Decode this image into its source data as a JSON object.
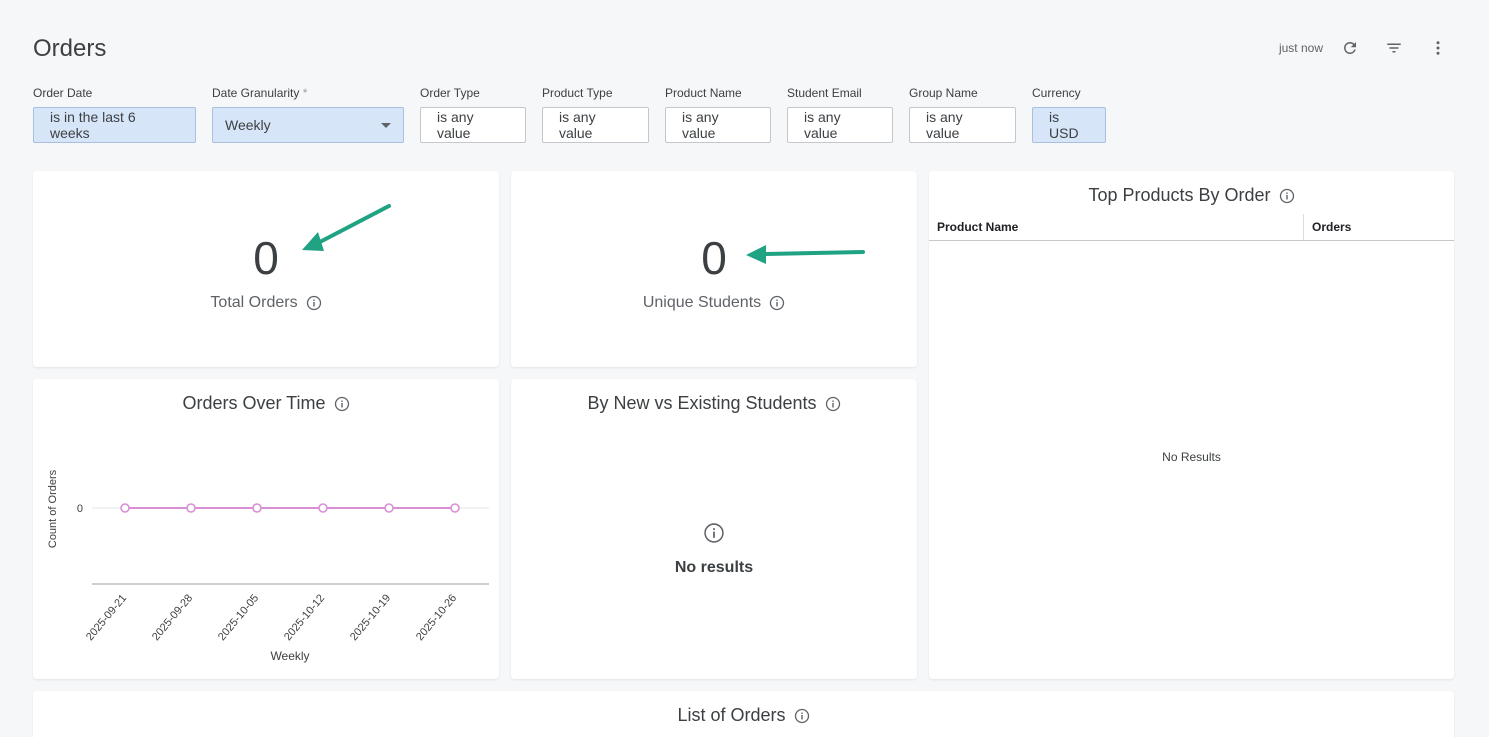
{
  "header": {
    "title": "Orders",
    "refresh_status": "just now",
    "icons": [
      "refresh-icon",
      "filter-icon",
      "more-vert-icon"
    ]
  },
  "filters": [
    {
      "label": "Order Date",
      "value": "is in the last 6 weeks",
      "active": true
    },
    {
      "label": "Date Granularity",
      "required_mark": "*",
      "value": "Weekly",
      "type": "select",
      "active": true
    },
    {
      "label": "Order Type",
      "value": "is any value",
      "active": false
    },
    {
      "label": "Product Type",
      "value": "is any value",
      "active": false
    },
    {
      "label": "Product Name",
      "value": "is any value",
      "active": false
    },
    {
      "label": "Student Email",
      "value": "is any value",
      "active": false
    },
    {
      "label": "Group Name",
      "value": "is any value",
      "active": false
    },
    {
      "label": "Currency",
      "value": "is USD",
      "active": true
    }
  ],
  "kpis": {
    "total_orders": {
      "value": "0",
      "label": "Total Orders"
    },
    "unique_students": {
      "value": "0",
      "label": "Unique Students"
    }
  },
  "top_products": {
    "title": "Top Products By Order",
    "columns": [
      "Product Name",
      "Orders"
    ],
    "empty_text": "No Results"
  },
  "orders_over_time": {
    "title": "Orders Over Time"
  },
  "new_vs_existing": {
    "title": "By New vs Existing Students",
    "empty_text": "No results"
  },
  "list_of_orders": {
    "title": "List of Orders"
  },
  "colors": {
    "series_line": "#d98fd6",
    "annotation_arrow": "#1fa383",
    "active_filter_bg": "#d7e5f8"
  },
  "chart_data": {
    "type": "line",
    "x": [
      "2025-09-21",
      "2025-09-28",
      "2025-10-05",
      "2025-10-12",
      "2025-10-19",
      "2025-10-26"
    ],
    "series": [
      {
        "values": [
          0,
          0,
          0,
          0,
          0,
          0
        ]
      }
    ],
    "xlabel": "Weekly",
    "ylabel": "Count of Orders",
    "y_ticks": [
      "0"
    ],
    "grid": true
  }
}
